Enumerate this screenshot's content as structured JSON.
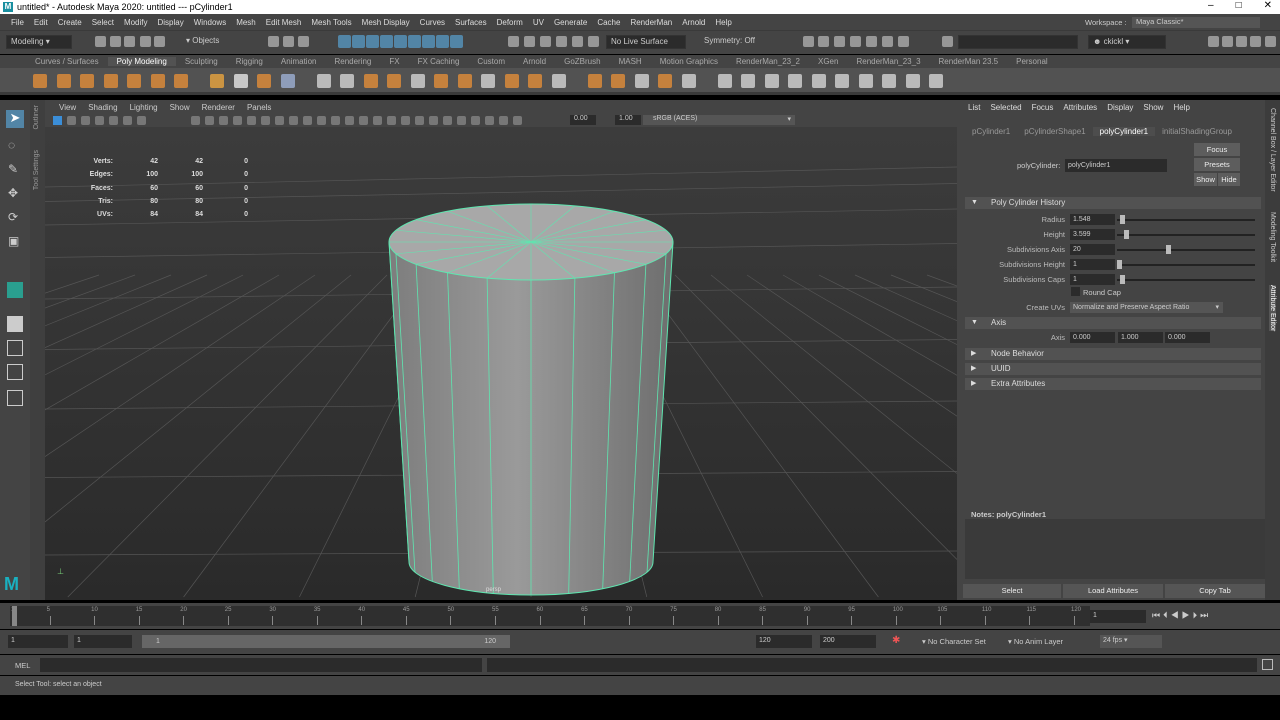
{
  "title": "untitled* - Autodesk Maya 2020: untitled   ---   pCylinder1",
  "window_controls": [
    "–",
    "□",
    "✕"
  ],
  "menus": [
    "File",
    "Edit",
    "Create",
    "Select",
    "Modify",
    "Display",
    "Windows",
    "Mesh",
    "Edit Mesh",
    "Mesh Tools",
    "Mesh Display",
    "Curves",
    "Surfaces",
    "Deform",
    "UV",
    "Generate",
    "Cache",
    "RenderMan",
    "Arnold",
    "Help"
  ],
  "toolbar": {
    "mode": "Modeling",
    "objects": "Objects",
    "live_surface": "No Live Surface",
    "symmetry": "Symmetry: Off",
    "workspace_label": "Workspace :",
    "workspace": "Maya Classic*",
    "user": "ckickl"
  },
  "shelf_tabs": [
    "Curves / Surfaces",
    "Poly Modeling",
    "Sculpting",
    "Rigging",
    "Animation",
    "Rendering",
    "FX",
    "FX Caching",
    "Custom",
    "Arnold",
    "GoZBrush",
    "MASH",
    "Motion Graphics",
    "RenderMan_23_2",
    "XGen",
    "RenderMan_23_3",
    "RenderMan 23.5",
    "Personal"
  ],
  "active_shelf": "Poly Modeling",
  "side_tabs": {
    "outliner": "Outliner",
    "tool_settings": "Tool Settings"
  },
  "viewport": {
    "menus": [
      "View",
      "Shading",
      "Lighting",
      "Show",
      "Renderer",
      "Panels"
    ],
    "near": "0.00",
    "far": "1.00",
    "colorspace": "sRGB (ACES)",
    "camera": "persp",
    "hud": [
      [
        "Verts:",
        "42",
        "42",
        "0"
      ],
      [
        "Edges:",
        "100",
        "100",
        "0"
      ],
      [
        "Faces:",
        "60",
        "60",
        "0"
      ],
      [
        "Tris:",
        "80",
        "80",
        "0"
      ],
      [
        "UVs:",
        "84",
        "84",
        "0"
      ]
    ]
  },
  "attribute_editor": {
    "menus": [
      "List",
      "Selected",
      "Focus",
      "Attributes",
      "Display",
      "Show",
      "Help"
    ],
    "tabs": [
      "pCylinder1",
      "pCylinderShape1",
      "polyCylinder1",
      "initialShadingGroup"
    ],
    "active_tab": "polyCylinder1",
    "node_label": "polyCylinder:",
    "node_name": "polyCylinder1",
    "buttons": {
      "focus": "Focus",
      "presets": "Presets",
      "show": "Show",
      "hide": "Hide"
    },
    "section_history": "Poly Cylinder History",
    "attrs": [
      {
        "label": "Radius",
        "value": "1.548",
        "slider": 0.02
      },
      {
        "label": "Height",
        "value": "3.599",
        "slider": 0.05
      },
      {
        "label": "Subdivisions Axis",
        "value": "20",
        "slider": 0.37
      },
      {
        "label": "Subdivisions Height",
        "value": "1",
        "slider": 0.0
      },
      {
        "label": "Subdivisions Caps",
        "value": "1",
        "slider": 0.02
      }
    ],
    "round_cap": "Round Cap",
    "create_uvs_label": "Create UVs",
    "create_uvs": "Normalize and Preserve Aspect Ratio",
    "section_axis": "Axis",
    "axis_label": "Axis",
    "axis": [
      "0.000",
      "1.000",
      "0.000"
    ],
    "collapsed": [
      "Node Behavior",
      "UUID",
      "Extra Attributes"
    ],
    "notes": "Notes:  polyCylinder1",
    "bottom_buttons": [
      "Select",
      "Load Attributes",
      "Copy Tab"
    ],
    "vertical_tabs": [
      "Channel Box / Layer Editor",
      "Modeling Toolkit",
      "Attribute Editor"
    ]
  },
  "timeline": {
    "ticks": [
      "1",
      "5",
      "10",
      "15",
      "20",
      "25",
      "30",
      "35",
      "40",
      "45",
      "50",
      "55",
      "60",
      "65",
      "70",
      "75",
      "80",
      "85",
      "90",
      "95",
      "100",
      "105",
      "110",
      "115",
      "120"
    ],
    "current": "1"
  },
  "range": {
    "start": "1",
    "anim_start": "1",
    "slider_start": "1",
    "slider_end": "120",
    "end": "120",
    "anim_end": "200",
    "char_set": "No Character Set",
    "anim_layer": "No Anim Layer",
    "fps": "24 fps"
  },
  "cmd": {
    "lang": "MEL"
  },
  "help_line": "Select Tool: select an object"
}
